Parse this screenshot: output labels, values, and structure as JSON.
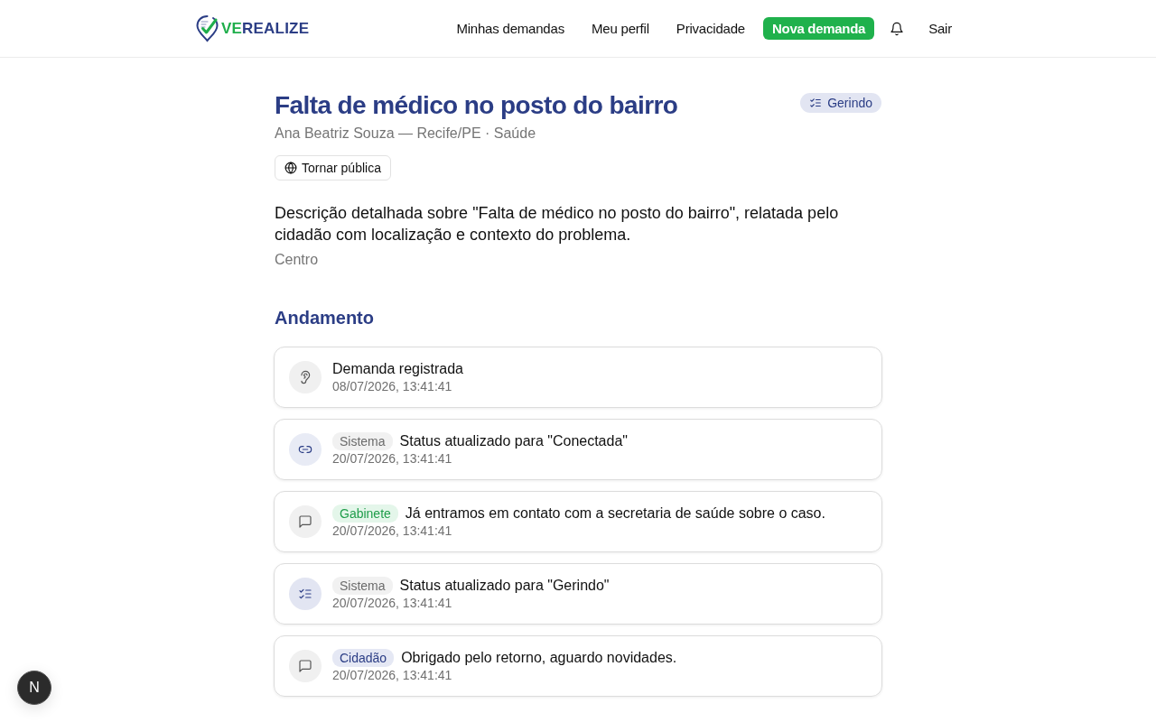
{
  "header": {
    "logo": {
      "accent": "VE",
      "rest": "REALIZE"
    },
    "nav": [
      {
        "kind": "link",
        "label": "Minhas demandas"
      },
      {
        "kind": "link",
        "label": "Meu perfil"
      },
      {
        "kind": "link",
        "label": "Privacidade"
      },
      {
        "kind": "primary",
        "label": "Nova demanda"
      },
      {
        "kind": "bell"
      },
      {
        "kind": "link",
        "label": "Sair"
      }
    ]
  },
  "demand": {
    "title": "Falta de médico no posto do bairro",
    "status": {
      "kind": "managing",
      "label": "Gerindo"
    },
    "meta": "Ana Beatriz Souza — Recife/PE · Saúde",
    "visibility_button": "Tornar pública",
    "description": "Descrição detalhada sobre \"Falta de médico no posto do bairro\", relatada pelo cidadão com localização e contexto do problema.",
    "neighborhood": "Centro"
  },
  "timeline": {
    "title": "Andamento",
    "events": [
      {
        "kind": "ear",
        "text": "Demanda registrada",
        "time": "08/07/2026, 13:41:41"
      },
      {
        "kind": "link",
        "author": {
          "kind": "system",
          "label": "Sistema"
        },
        "text": "Status atualizado para \"Conectada\"",
        "time": "20/07/2026, 13:41:41"
      },
      {
        "kind": "chat",
        "author": {
          "kind": "office",
          "label": "Gabinete"
        },
        "text": "Já entramos em contato com a secretaria de saúde sobre o caso.",
        "time": "20/07/2026, 13:41:41"
      },
      {
        "kind": "checklist",
        "author": {
          "kind": "system",
          "label": "Sistema"
        },
        "text": "Status atualizado para \"Gerindo\"",
        "time": "20/07/2026, 13:41:41"
      },
      {
        "kind": "chat",
        "author": {
          "kind": "citizen",
          "label": "Cidadão"
        },
        "text": "Obrigado pelo retorno, aguardo novidades.",
        "time": "20/07/2026, 13:41:41"
      }
    ]
  },
  "dev_indicator": {
    "label": "N"
  }
}
